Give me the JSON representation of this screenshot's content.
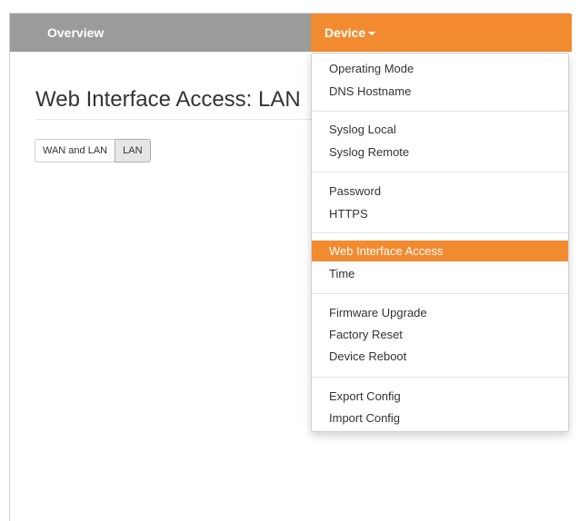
{
  "navbar": {
    "overview_label": "Overview",
    "device_label": "Device"
  },
  "page": {
    "title": "Web Interface Access: LAN"
  },
  "toggle": {
    "options": [
      "WAN and LAN",
      "LAN"
    ],
    "selected": "LAN"
  },
  "menu": {
    "groups": [
      [
        "Operating Mode",
        "DNS Hostname"
      ],
      [
        "Syslog Local",
        "Syslog Remote"
      ],
      [
        "Password",
        "HTTPS"
      ],
      [
        "Web Interface Access",
        "Time"
      ],
      [
        "Firmware Upgrade",
        "Factory Reset",
        "Device Reboot"
      ],
      [
        "Export Config",
        "Import Config"
      ]
    ],
    "active_item": "Web Interface Access"
  },
  "colors": {
    "accent": "#f28b30",
    "navbar": "#9b9b9b"
  }
}
